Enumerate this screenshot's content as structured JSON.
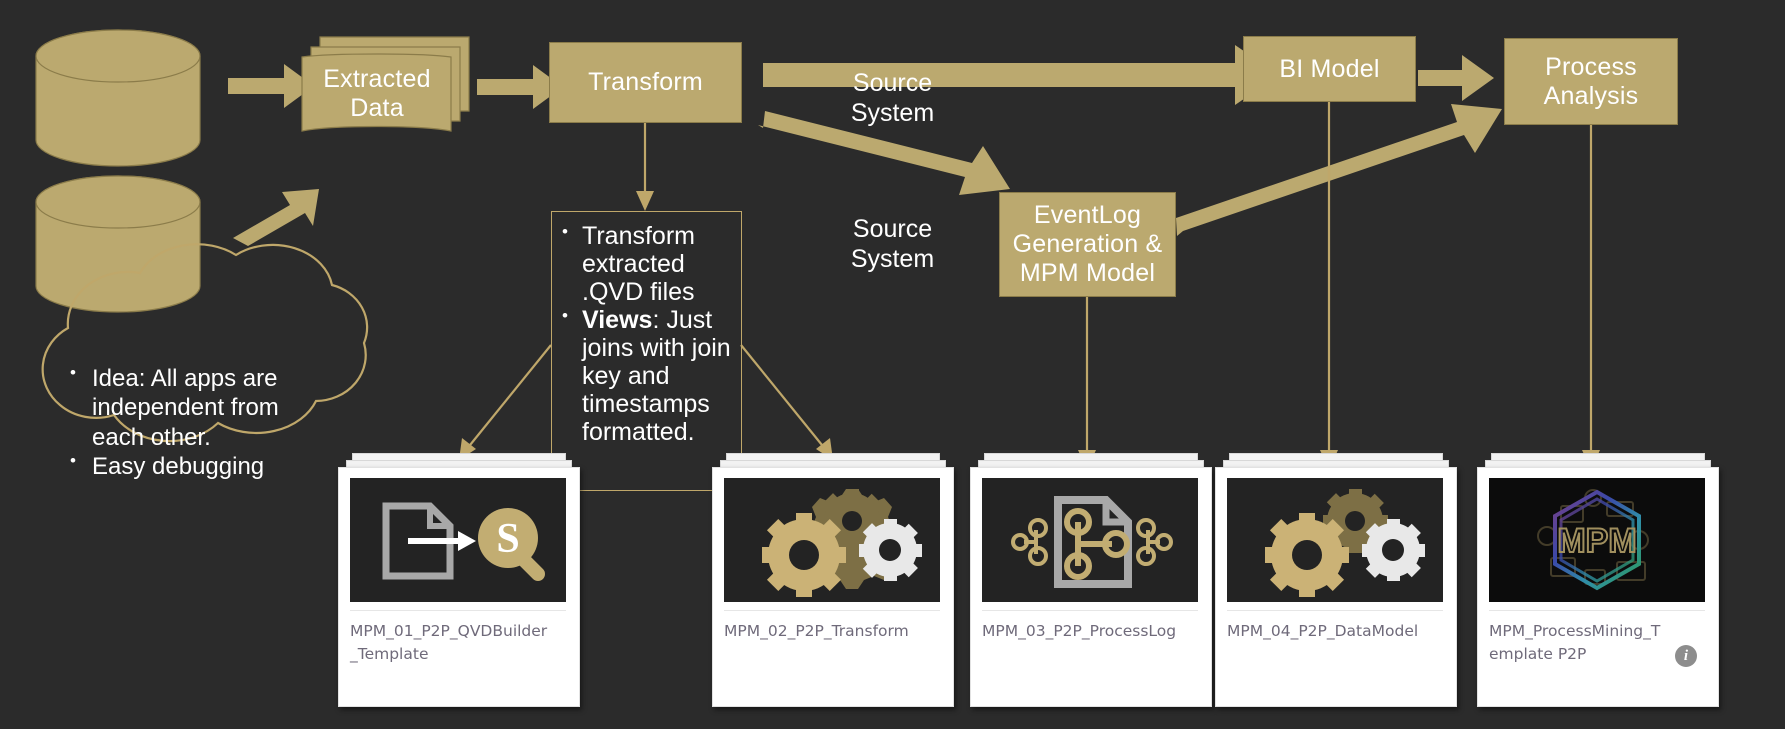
{
  "theme": {
    "background": "#2b2b2b",
    "gold": "#bba96f",
    "gold_stroke": "#8b7c4a",
    "gold_line": "#bfa76a",
    "text_on_gold": "#ffffff",
    "card_bg": "#ffffff",
    "thumb_bg": "#232323",
    "card_label_color": "#6f6a7a"
  },
  "flow": {
    "source_system_1": "Source\nSystem",
    "source_system_1_line1": "Source",
    "source_system_1_line2": "System",
    "source_system_2_line1": "Source",
    "source_system_2_line2": "System",
    "extracted_data_line1": "Extracted",
    "extracted_data_line2": "Data",
    "transform": "Transform",
    "bi_model": "BI Model",
    "eventlog_line1": "EventLog",
    "eventlog_line2": "Generation &",
    "eventlog_line3": "MPM Model",
    "process_analysis_line1": "Process",
    "process_analysis_line2": "Analysis"
  },
  "transform_notes": {
    "bullet1": "Transform extracted .QVD files",
    "bullet2_label": "Views",
    "bullet2_rest": ": Just joins with join key and timestamps formatted."
  },
  "cloud_note": {
    "bullet1": "Idea: All apps are independent from each other.",
    "bullet2": "Easy debugging"
  },
  "apps": [
    {
      "id": "app-01",
      "label": "MPM_01_P2P_QVDBuilder_Template",
      "icon": "qvd-builder-icon",
      "has_info_icon": false
    },
    {
      "id": "app-02",
      "label": "MPM_02_P2P_Transform",
      "icon": "gears-icon",
      "has_info_icon": false
    },
    {
      "id": "app-03",
      "label": "MPM_03_P2P_ProcessLog",
      "icon": "process-log-icon",
      "has_info_icon": false
    },
    {
      "id": "app-04",
      "label": "MPM_04_P2P_DataModel",
      "icon": "gears-icon",
      "has_info_icon": false
    },
    {
      "id": "app-05",
      "label": "MPM_ProcessMining_Template P2P",
      "icon": "mpm-hexagon-icon",
      "has_info_icon": true,
      "info_glyph": "i"
    }
  ]
}
